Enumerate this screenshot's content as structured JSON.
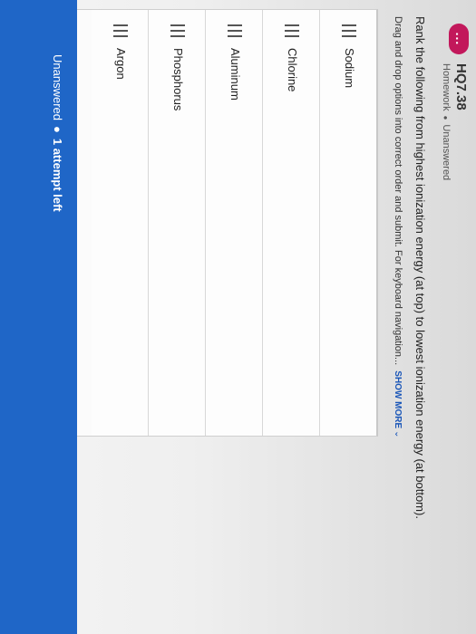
{
  "question": {
    "badge": "...",
    "id": "HQ7.38",
    "type": "Homework",
    "status": "Unanswered",
    "prompt": "Rank the following from highest ionization energy (at top) to lowest ionization energy (at bottom).",
    "instructions": "Drag and drop options into correct order and submit. For keyboard navigation...",
    "show_more_label": "SHOW MORE"
  },
  "items": [
    {
      "label": "Sodium"
    },
    {
      "label": "Chlorine"
    },
    {
      "label": "Aluminum"
    },
    {
      "label": "Phosphorus"
    },
    {
      "label": "Argon"
    }
  ],
  "footer": {
    "status": "Unanswered",
    "attempts": "1 attempt left"
  },
  "colors": {
    "accent": "#1f66c7",
    "badge": "#c2185b"
  }
}
